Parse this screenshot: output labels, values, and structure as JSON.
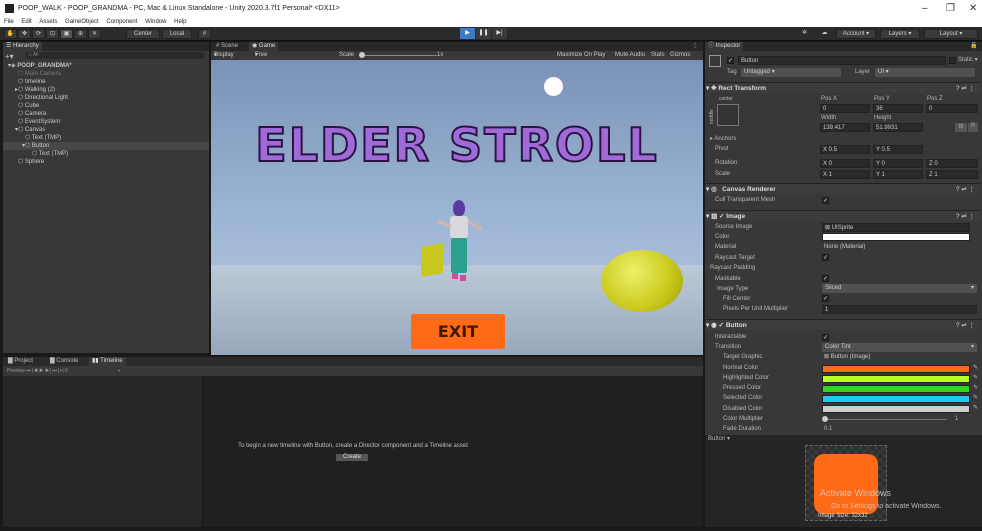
{
  "window": {
    "title": "POOP_WALK - POOP_GRANDMA - PC, Mac & Linux Standalone - Unity 2020.3.7f1 Personal* <DX11>",
    "min": "–",
    "max": "❐",
    "close": "✕"
  },
  "menu": [
    "File",
    "Edit",
    "Assets",
    "GameObject",
    "Component",
    "Window",
    "Help"
  ],
  "toolbar": {
    "center": "Center",
    "local": "Local",
    "account": "Account",
    "layers": "Layers",
    "layout": "Layout"
  },
  "hierarchy": {
    "tab": "Hierarchy",
    "search": "All",
    "rows": [
      {
        "label": "POOP_GRANDMA*",
        "indent": 0,
        "arrow": "▾",
        "style": "bold"
      },
      {
        "label": "Main Camera",
        "indent": 1,
        "arrow": "",
        "style": "dim"
      },
      {
        "label": "timeline",
        "indent": 1,
        "arrow": "",
        "style": ""
      },
      {
        "label": "Walking (2)",
        "indent": 1,
        "arrow": "▸",
        "style": ""
      },
      {
        "label": "Directional Light",
        "indent": 1,
        "arrow": "",
        "style": ""
      },
      {
        "label": "Cube",
        "indent": 1,
        "arrow": "",
        "style": ""
      },
      {
        "label": "Camera",
        "indent": 1,
        "arrow": "",
        "style": ""
      },
      {
        "label": "EventSystem",
        "indent": 1,
        "arrow": "",
        "style": ""
      },
      {
        "label": "Canvas",
        "indent": 1,
        "arrow": "▾",
        "style": ""
      },
      {
        "label": "Text (TMP)",
        "indent": 2,
        "arrow": "",
        "style": ""
      },
      {
        "label": "Button",
        "indent": 2,
        "arrow": "▾",
        "style": "sel"
      },
      {
        "label": "Text (TMP)",
        "indent": 3,
        "arrow": "",
        "style": ""
      },
      {
        "label": "Sphere",
        "indent": 1,
        "arrow": "",
        "style": ""
      }
    ]
  },
  "game": {
    "tabs": [
      "Scene",
      "Game"
    ],
    "display": "Display 1",
    "aspect": "Free Aspect",
    "scale": "Scale",
    "scale_val": "1x",
    "toggles": [
      "Maximize On Play",
      "Mute Audio",
      "Stats",
      "Gizmos"
    ],
    "title_text": "ELDER STROLL",
    "button_text": "EXIT"
  },
  "bottom": {
    "tabs": [
      "Project",
      "Console",
      "Timeline"
    ],
    "preview": "Preview",
    "message": "To begin a new timeline with Button, create a Director component and a Timeline asset",
    "create": "Create"
  },
  "inspector": {
    "tab": "Inspector",
    "name": "Button",
    "static": "Static",
    "tag_label": "Tag",
    "tag": "Untagged",
    "layer_label": "Layer",
    "layer": "UI",
    "rect": {
      "header": "Rect Transform",
      "center": "center",
      "middle": "middle",
      "cols": [
        "Pos X",
        "Pos Y",
        "Pos Z"
      ],
      "vals": [
        "0",
        "36",
        "0"
      ],
      "wh_labels": [
        "Width",
        "Height"
      ],
      "wh": [
        "139.417",
        "51.9931"
      ],
      "anchors": "Anchors",
      "pivot": "Pivot",
      "pivot_x": "X 0.5",
      "pivot_y": "Y 0.5",
      "rotation": "Rotation",
      "rot": [
        "X 0",
        "Y 0",
        "Z 0"
      ],
      "scale": "Scale",
      "scl": [
        "X 1",
        "Y 1",
        "Z 1"
      ]
    },
    "canvas_renderer": {
      "header": "Canvas Renderer",
      "cull": "Cull Transparent Mesh"
    },
    "image": {
      "header": "Image",
      "rows": [
        "Source Image",
        "Color",
        "Material",
        "Raycast Target",
        "Raycast Padding",
        "Maskable",
        "Image Type",
        "Fill Center",
        "Pixels Per Unit Multiplier"
      ],
      "source": "UISprite",
      "material": "None (Material)",
      "type": "Sliced",
      "ppu": "1"
    },
    "button": {
      "header": "Button",
      "rows": [
        "Interactable",
        "Transition",
        "Target Graphic",
        "Normal Color",
        "Highlighted Color",
        "Pressed Color",
        "Selected Color",
        "Disabled Color",
        "Color Multiplier",
        "Fade Duration"
      ],
      "transition": "Color Tint",
      "target": "Button (Image)",
      "multiplier": "1",
      "fade": "0.1",
      "colors": [
        "#ff6a16",
        "#b6ff2a",
        "#2bdc1a",
        "#21c9f0",
        "#cfcfcf"
      ]
    },
    "preview_label": "Button",
    "image_size": "Image Size: 32x32",
    "watermark1": "Activate Windows",
    "watermark2": "Go to Settings to activate Windows."
  }
}
